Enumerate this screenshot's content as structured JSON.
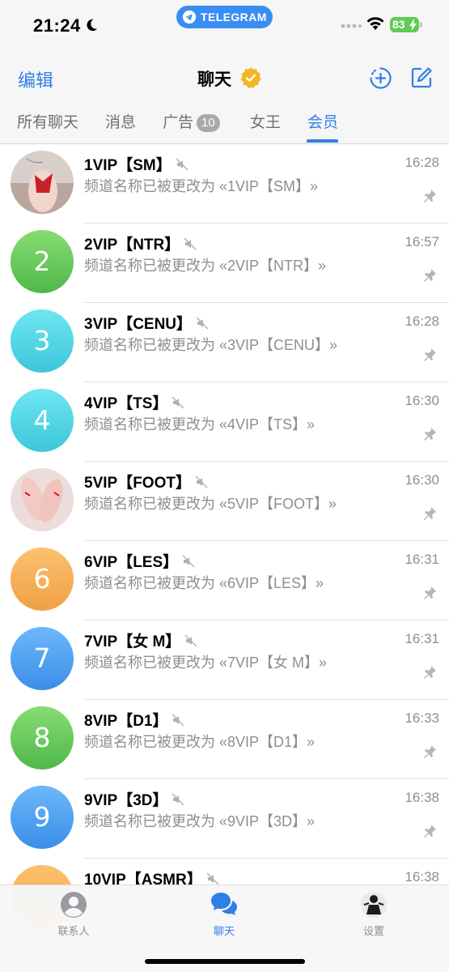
{
  "status_bar": {
    "time": "21:24",
    "moon_icon": "moon-icon",
    "pill_label": "TELEGRAM",
    "battery": "83",
    "accent": "#3a8df2"
  },
  "nav": {
    "edit": "编辑",
    "title": "聊天",
    "new_story_icon": "plus-circle-icon",
    "compose_icon": "compose-icon"
  },
  "tabs": [
    {
      "label": "所有聊天"
    },
    {
      "label": "消息"
    },
    {
      "label": "广告",
      "badge": "10"
    },
    {
      "label": "女王"
    },
    {
      "label": "会员",
      "active": true
    }
  ],
  "chats": [
    {
      "name": "1VIP【SM】",
      "time": "16:28",
      "message": "频道名称已被更改为 «1VIP【SM】»",
      "avatar": "photo"
    },
    {
      "name": "2VIP【NTR】",
      "time": "16:57",
      "message": "频道名称已被更改为 «2VIP【NTR】»",
      "avatar": "2",
      "color": "#5fc35a"
    },
    {
      "name": "3VIP【CENU】",
      "time": "16:28",
      "message": "频道名称已被更改为 «3VIP【CENU】»",
      "avatar": "3",
      "color": "#45cfe0"
    },
    {
      "name": "4VIP【TS】",
      "time": "16:30",
      "message": "频道名称已被更改为 «4VIP【TS】»",
      "avatar": "4",
      "color": "#45cfe0"
    },
    {
      "name": "5VIP【FOOT】",
      "time": "16:30",
      "message": "频道名称已被更改为 «5VIP【FOOT】»",
      "avatar": "photo"
    },
    {
      "name": "6VIP【LES】",
      "time": "16:31",
      "message": "频道名称已被更改为 «6VIP【LES】»",
      "avatar": "6",
      "color": "#f2a74a"
    },
    {
      "name": "7VIP【女 M】",
      "time": "16:31",
      "message": "频道名称已被更改为 «7VIP【女 M】»",
      "avatar": "7",
      "color": "#3e97ee"
    },
    {
      "name": "8VIP【D1】",
      "time": "16:33",
      "message": "频道名称已被更改为 «8VIP【D1】»",
      "avatar": "8",
      "color": "#5fc35a"
    },
    {
      "name": "9VIP【3D】",
      "time": "16:38",
      "message": "频道名称已被更改为 «9VIP【3D】»",
      "avatar": "9",
      "color": "#3e97ee"
    },
    {
      "name": "10VIP【ASMR】",
      "time": "16:38",
      "message": "",
      "avatar": "",
      "color": "#f2a74a"
    }
  ],
  "tabbar": [
    {
      "label": "联系人",
      "icon": "person-circle-icon"
    },
    {
      "label": "聊天",
      "icon": "chat-bubbles-icon",
      "active": true
    },
    {
      "label": "设置",
      "icon": "profile-avatar-icon"
    }
  ]
}
